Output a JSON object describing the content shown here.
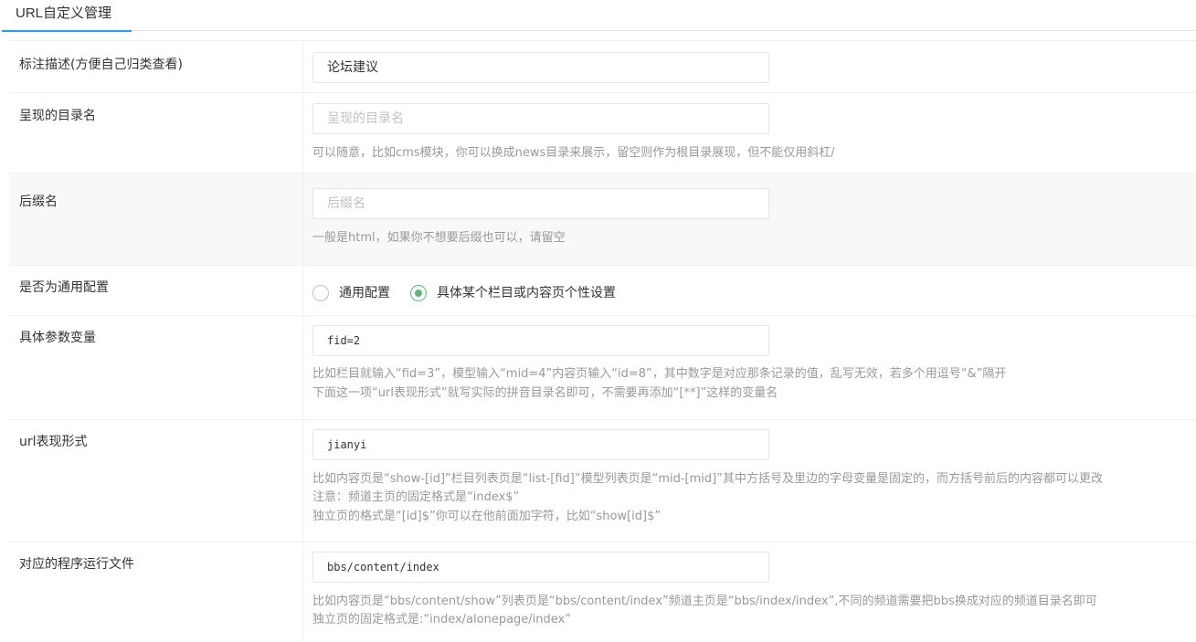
{
  "tab": {
    "label": "URL自定义管理"
  },
  "fields": {
    "description": {
      "label": "标注描述(方便自己归类查看)",
      "value": "论坛建议"
    },
    "dirname": {
      "label": "呈现的目录名",
      "placeholder": "呈现的目录名",
      "help": "可以随意，比如cms模块，你可以换成news目录来展示，留空则作为根目录展现，但不能仅用斜杠/"
    },
    "suffix": {
      "label": "后缀名",
      "placeholder": "后缀名",
      "help": "一般是html，如果你不想要后缀也可以，请留空"
    },
    "is_general": {
      "label": "是否为通用配置",
      "options": [
        {
          "label": "通用配置",
          "checked": false
        },
        {
          "label": "具体某个栏目或内容页个性设置",
          "checked": true
        }
      ]
    },
    "params": {
      "label": "具体参数变量",
      "value": "fid=2",
      "help": [
        "比如栏目就输入“fid=3”，模型输入“mid=4”内容页输入“id=8”，其中数字是对应那条记录的值，乱写无效，若多个用逗号“&”隔开",
        "下面这一项“url表现形式”就写实际的拼音目录名即可，不需要再添加“[**]”这样的变量名"
      ]
    },
    "url_form": {
      "label": "url表现形式",
      "value": "jianyi",
      "help": [
        "比如内容页是“show-[id]”栏目列表页是“list-[fid]”模型列表页是“mid-[mid]”其中方括号及里边的字母变量是固定的，而方括号前后的内容都可以更改",
        "注意：频道主页的固定格式是“index$”",
        "独立页的格式是“[id]$”你可以在他前面加字符，比如“show[id]$”"
      ]
    },
    "program": {
      "label": "对应的程序运行文件",
      "value": "bbs/content/index",
      "help": [
        "比如内容页是“bbs/content/show”列表页是“bbs/content/index”频道主页是“bbs/index/index”,不同的频道需要把bbs换成对应的频道目录名即可",
        "独立页的固定格式是:“index/alonepage/index”"
      ]
    }
  }
}
